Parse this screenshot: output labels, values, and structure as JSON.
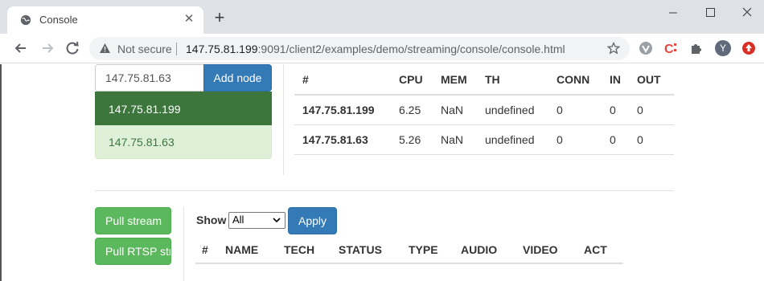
{
  "browser": {
    "tab_title": "Console",
    "security_label": "Not secure",
    "url_host": "147.75.81.199",
    "url_rest": ":9091/client2/examples/demo/streaming/console/console.html",
    "profile_initial": "Y"
  },
  "nodes": {
    "input_value": "147.75.81.63",
    "add_label": "Add node",
    "list": [
      "147.75.81.199",
      "147.75.81.63"
    ]
  },
  "node_table": {
    "headers": [
      "#",
      "CPU",
      "MEM",
      "TH",
      "CONN",
      "IN",
      "OUT"
    ],
    "rows": [
      [
        "147.75.81.199",
        "6.25",
        "NaN",
        "undefined",
        "0",
        "0",
        "0"
      ],
      [
        "147.75.81.63",
        "5.26",
        "NaN",
        "undefined",
        "0",
        "0",
        "0"
      ]
    ]
  },
  "streams": {
    "pull_stream_label": "Pull stream",
    "pull_rtsp_label": "Pull RTSP stream",
    "show_label": "Show",
    "show_selected": "All",
    "apply_label": "Apply",
    "headers": [
      "#",
      "NAME",
      "TECH",
      "STATUS",
      "TYPE",
      "AUDIO",
      "VIDEO",
      "ACT"
    ]
  },
  "colors": {
    "primary": "#337ab7",
    "success": "#5cb85c",
    "active_node": "#3c763d",
    "inactive_node": "#dff0d8"
  }
}
